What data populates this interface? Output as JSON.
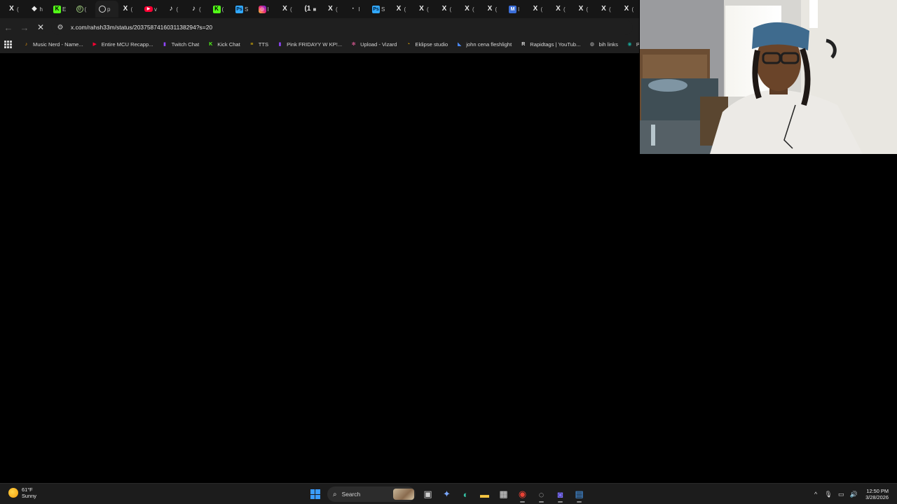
{
  "browser": {
    "tabs": [
      {
        "icon": "x-icon",
        "glyph": "X",
        "cls": "x",
        "ch": "("
      },
      {
        "icon": "diamond-icon",
        "glyph": "◆",
        "cls": "x",
        "ch": "h"
      },
      {
        "icon": "kick-icon",
        "glyph": "K",
        "cls": "k",
        "ch": "E"
      },
      {
        "icon": "ring-icon",
        "glyph": "@",
        "cls": "ring",
        "ch": "("
      },
      {
        "icon": "google-icon",
        "glyph": "",
        "cls": "circle",
        "ch": "p",
        "active": true
      },
      {
        "icon": "x-icon",
        "glyph": "X",
        "cls": "x",
        "ch": "("
      },
      {
        "icon": "youtube-icon",
        "glyph": "▶",
        "cls": "yt",
        "ch": "v"
      },
      {
        "icon": "tiktok-icon",
        "glyph": "♪",
        "cls": "tt",
        "ch": "("
      },
      {
        "icon": "tiktok-icon",
        "glyph": "♪",
        "cls": "tt",
        "ch": "("
      },
      {
        "icon": "kick-icon",
        "glyph": "K",
        "cls": "k",
        "ch": "("
      },
      {
        "icon": "photoshop-icon",
        "glyph": "Ps",
        "cls": "ps",
        "ch": "S"
      },
      {
        "icon": "instagram-icon",
        "glyph": "◎",
        "cls": "ig",
        "ch": "I"
      },
      {
        "icon": "x-icon",
        "glyph": "X",
        "cls": "x",
        "ch": "("
      },
      {
        "icon": "x-icon",
        "glyph": "(1",
        "cls": "x",
        "ch": "■"
      },
      {
        "icon": "x-icon",
        "glyph": "X",
        "cls": "x",
        "ch": "("
      },
      {
        "icon": "spinner-icon",
        "glyph": "·",
        "cls": "x",
        "ch": "I"
      },
      {
        "icon": "photoshop-icon",
        "glyph": "Ps",
        "cls": "ps",
        "ch": "S"
      },
      {
        "icon": "x-icon",
        "glyph": "X",
        "cls": "x",
        "ch": "("
      },
      {
        "icon": "x-icon",
        "glyph": "X",
        "cls": "x",
        "ch": "("
      },
      {
        "icon": "x-icon",
        "glyph": "X",
        "cls": "x",
        "ch": "("
      },
      {
        "icon": "x-icon",
        "glyph": "X",
        "cls": "x",
        "ch": "("
      },
      {
        "icon": "x-icon",
        "glyph": "X",
        "cls": "x",
        "ch": "("
      },
      {
        "icon": "gmail-icon",
        "glyph": "M",
        "cls": "gm",
        "ch": "I"
      },
      {
        "icon": "x-icon",
        "glyph": "X",
        "cls": "x",
        "ch": "("
      },
      {
        "icon": "x-icon",
        "glyph": "X",
        "cls": "x",
        "ch": "("
      },
      {
        "icon": "x-icon",
        "glyph": "X",
        "cls": "x",
        "ch": "("
      },
      {
        "icon": "x-icon",
        "glyph": "X",
        "cls": "x",
        "ch": "("
      },
      {
        "icon": "x-icon",
        "glyph": "X",
        "cls": "x",
        "ch": "("
      }
    ],
    "url": "x.com/rahsh33m/status/2037587416031138294?s=20",
    "bookmarks": [
      {
        "label": "Music Nerd - Name...",
        "icon": "music-nerd-icon",
        "color": "#f59e0b",
        "glyph": "♪"
      },
      {
        "label": "Entire MCU Recapp...",
        "icon": "youtube-icon",
        "color": "#ff0033",
        "glyph": "▶"
      },
      {
        "label": "Twitch Chat",
        "icon": "twitch-icon",
        "color": "#9146ff",
        "glyph": "▮"
      },
      {
        "label": "Kick Chat",
        "icon": "kick-icon",
        "color": "#53fc18",
        "glyph": "K"
      },
      {
        "label": "TTS",
        "icon": "tts-icon",
        "color": "#f2c200",
        "glyph": "≡"
      },
      {
        "label": "Pink FRIDAYY W KP!...",
        "icon": "twitch-icon",
        "color": "#9146ff",
        "glyph": "▮"
      },
      {
        "label": "Upload - Vizard",
        "icon": "vizard-icon",
        "color": "#e85d9c",
        "glyph": "✻"
      },
      {
        "label": "Eklipse studio",
        "icon": "eklipse-icon",
        "color": "#f5b400",
        "glyph": "◔"
      },
      {
        "label": "john cena fleshlight",
        "icon": "bookmark-page-icon",
        "color": "#4b8cff",
        "glyph": "◣"
      },
      {
        "label": "Rapidtags | YouTub...",
        "icon": "rapidtags-icon",
        "color": "#e0e0e0",
        "glyph": "R"
      },
      {
        "label": "bih links",
        "icon": "globe-icon",
        "color": "#bdbdbd",
        "glyph": "◍"
      },
      {
        "label": "Photopea",
        "icon": "photopea-icon",
        "color": "#18a497",
        "glyph": "◉"
      }
    ]
  },
  "taskbar": {
    "weather": {
      "temp": "61°F",
      "condition": "Sunny"
    },
    "search_label": "Search",
    "apps": [
      {
        "name": "task-view-button",
        "icon": "task-view-icon",
        "glyph": "▣",
        "color": "#cfcfcf"
      },
      {
        "name": "copilot-button",
        "icon": "copilot-icon",
        "glyph": "✦",
        "color": "#7aa7ff"
      },
      {
        "name": "edge-button",
        "icon": "edge-icon",
        "glyph": "◐",
        "color": "#35c1a4"
      },
      {
        "name": "file-explorer-button",
        "icon": "folder-icon",
        "glyph": "▬",
        "color": "#f5c542"
      },
      {
        "name": "store-button",
        "icon": "store-icon",
        "glyph": "▦",
        "color": "#e6e6e6"
      },
      {
        "name": "chrome-button",
        "icon": "chrome-icon",
        "glyph": "◉",
        "color": "#e94235",
        "running": true
      },
      {
        "name": "obs-button",
        "icon": "obs-icon",
        "glyph": "◌",
        "color": "#d0d0d0",
        "running": true
      },
      {
        "name": "discord-button",
        "icon": "discord-icon",
        "glyph": "◙",
        "color": "#7a6cff",
        "running": true
      },
      {
        "name": "notepad-button",
        "icon": "notepad-icon",
        "glyph": "▤",
        "color": "#4aa3ff",
        "running": true
      }
    ],
    "tray": [
      {
        "name": "show-hidden-icons-button",
        "icon": "chevron-up-icon",
        "glyph": "^"
      },
      {
        "name": "microphone-button",
        "icon": "microphone-icon",
        "glyph": "🎙"
      },
      {
        "name": "network-button",
        "icon": "network-icon",
        "glyph": "▭"
      },
      {
        "name": "volume-button",
        "icon": "speaker-icon",
        "glyph": "🔊"
      }
    ],
    "time": "12:50 PM",
    "date": "3/28/2026"
  }
}
